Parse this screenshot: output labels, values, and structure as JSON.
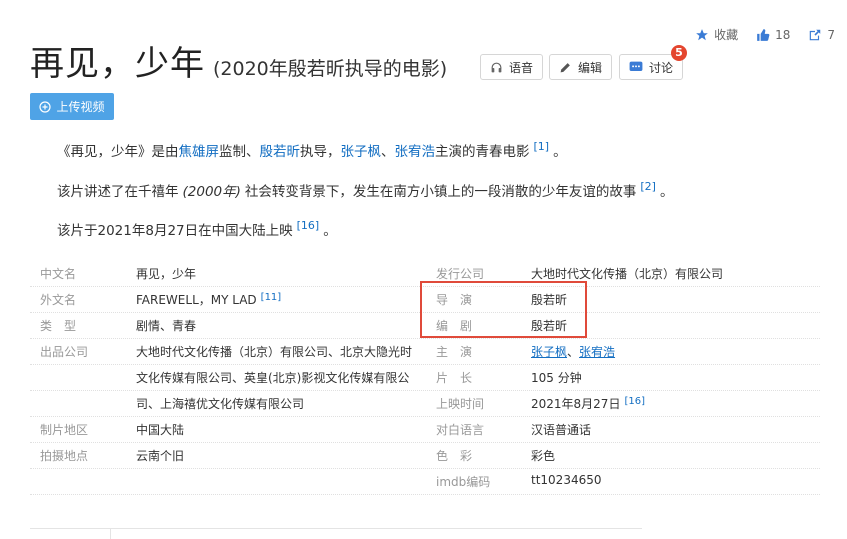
{
  "top_actions": {
    "favorite_label": "收藏",
    "like_count": "18",
    "share_count": "7"
  },
  "title": "再见，少年",
  "subtitle": "(2020年殷若昕执导的电影)",
  "toolbar": {
    "voice_label": "语音",
    "edit_label": "编辑",
    "discuss_label": "讨论",
    "discuss_badge": "5"
  },
  "upload_label": "上传视频",
  "intro": {
    "p1_pre": "《再见，少年》是由",
    "p1_link1": "焦雄屏",
    "p1_mid1": "监制、",
    "p1_link2": "殷若昕",
    "p1_mid2": "执导，",
    "p1_link3": "张子枫",
    "p1_mid3": "、",
    "p1_link4": "张宥浩",
    "p1_post": "主演的青春电影",
    "p1_ref": "[1]",
    "p1_end": "。",
    "p2_pre": "该片讲述了在千禧年",
    "p2_italic": "(2000年)",
    "p2_post": "社会转变背景下，发生在南方小镇上的一段消散的少年友谊的故事",
    "p2_ref": "[2]",
    "p2_end": "。",
    "p3_text": "该片于2021年8月27日在中国大陆上映",
    "p3_ref": "[16]",
    "p3_end": "。"
  },
  "info_left": [
    {
      "label": "中文名",
      "value": "再见，少年"
    },
    {
      "label": "外文名",
      "value": "FAREWELL，MY LAD",
      "ref": "[11]"
    },
    {
      "label": "类　型",
      "value": "剧情、青春"
    },
    {
      "label": "出品公司",
      "value": "大地时代文化传播（北京）有限公司、北京大隐光时"
    },
    {
      "label": "",
      "value": "文化传媒有限公司、英皇(北京)影视文化传媒有限公"
    },
    {
      "label": "",
      "value": "司、上海禧优文化传媒有限公司"
    },
    {
      "label": "制片地区",
      "value": "中国大陆"
    },
    {
      "label": "拍摄地点",
      "value": "云南个旧"
    }
  ],
  "info_right": [
    {
      "label": "发行公司",
      "value": "大地时代文化传播（北京）有限公司"
    },
    {
      "label": "导　演",
      "value": "殷若昕"
    },
    {
      "label": "编　剧",
      "value": "殷若昕"
    },
    {
      "label": "主　演",
      "value_link1": "张子枫",
      "value_sep": "、",
      "value_link2": "张宥浩"
    },
    {
      "label": "片　长",
      "value": "105 分钟"
    },
    {
      "label": "上映时间",
      "value": "2021年8月27日",
      "ref": "[16]"
    },
    {
      "label": "对白语言",
      "value": "汉语普通话"
    },
    {
      "label": "色　彩",
      "value": "彩色"
    },
    {
      "label": "imdb编码",
      "value": "tt10234650"
    }
  ],
  "colors": {
    "link": "#136ec2",
    "upload_button": "#4fa3e6",
    "badge": "#e4462f",
    "highlight_box": "#e04a3a"
  }
}
